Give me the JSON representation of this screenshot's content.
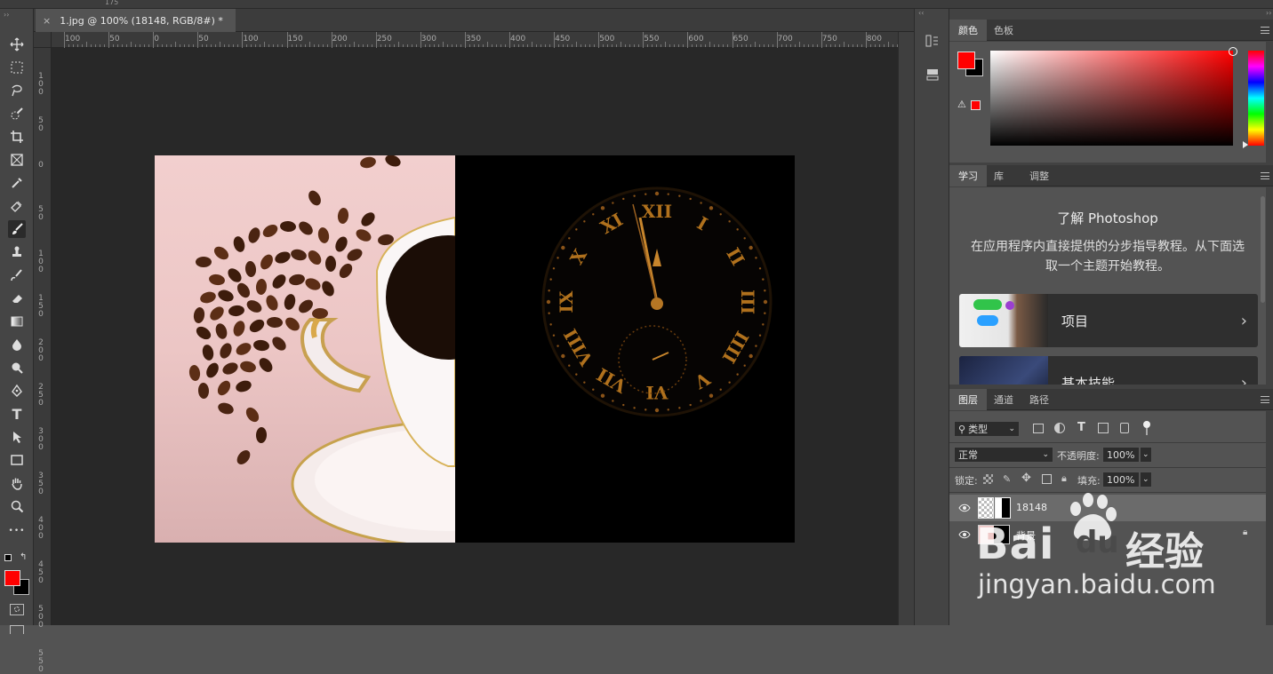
{
  "document": {
    "tab_close": "×",
    "tab_title": "1.jpg @ 100% (18148, RGB/8#) *"
  },
  "top_ruler": {
    "ticks": [
      "100",
      "50",
      "0",
      "50",
      "100",
      "150",
      "200",
      "250",
      "300",
      "350",
      "400",
      "450",
      "500",
      "550",
      "600",
      "650",
      "700",
      "750",
      "800"
    ]
  },
  "left_ruler": {
    "labels": [
      "1\n0\n0",
      "5\n0",
      "0",
      "5\n0",
      "1\n0\n0",
      "1\n5\n0",
      "2\n0\n0",
      "2\n5\n0",
      "3\n0\n0",
      "3\n5\n0",
      "4\n0\n0",
      "4\n5\n0",
      "5\n0\n0",
      "5\n5\n0"
    ]
  },
  "top_strip_text": "175",
  "toolbar": {
    "tools": [
      "move-tool",
      "marquee-tool",
      "lasso-tool",
      "quick-select-tool",
      "crop-tool",
      "frame-tool",
      "eyedropper-tool",
      "healing-tool",
      "brush-tool",
      "stamp-tool",
      "history-brush-tool",
      "eraser-tool",
      "gradient-tool",
      "blur-tool",
      "dodge-tool",
      "pen-tool",
      "type-tool",
      "path-select-tool",
      "rectangle-tool",
      "hand-tool",
      "zoom-tool",
      "more-tools"
    ],
    "type_tool_glyph": "T",
    "more_glyph": "•••",
    "foreground_color": "#ff0000",
    "background_color": "#000000"
  },
  "color_panel": {
    "tabs": [
      "颜色",
      "色板"
    ],
    "fg": "#ff0000",
    "bg": "#000000",
    "warning_glyph": "⚠"
  },
  "learn_panel": {
    "tabs": [
      "学习",
      "库",
      "调整"
    ],
    "heading": "了解 Photoshop",
    "description": "在应用程序内直接提供的分步指导教程。从下面选取一个主题开始教程。",
    "cards": [
      {
        "title": "项目"
      },
      {
        "title": "基本技能"
      }
    ]
  },
  "layers_panel": {
    "tabs": [
      "图层",
      "通道",
      "路径"
    ],
    "filter_label": "类型",
    "filter_icon_text": "T",
    "blend_mode": "正常",
    "opacity_label": "不透明度:",
    "opacity_value": "100%",
    "lock_label": "锁定:",
    "fill_label": "填充:",
    "fill_value": "100%",
    "layers": [
      {
        "name": "18148",
        "selected": true
      },
      {
        "name": "背景",
        "locked": true
      }
    ]
  },
  "watermark": {
    "brand": "Bai",
    "brand2": "du",
    "brand_cn": "经验",
    "url": "jingyan.baidu.com"
  },
  "clock": {
    "numerals": [
      "XII",
      "I",
      "II",
      "III",
      "IIII",
      "V",
      "VI",
      "VII",
      "VIII",
      "IX",
      "X",
      "XI"
    ]
  }
}
